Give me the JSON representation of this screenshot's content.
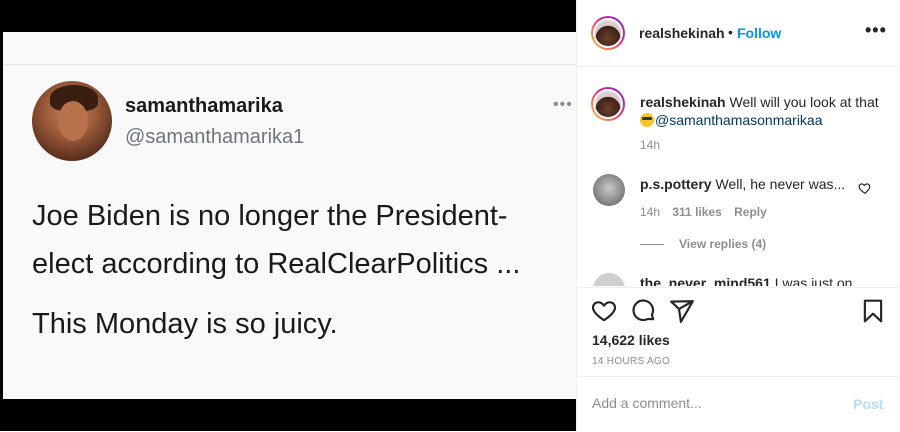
{
  "tweet": {
    "name": "samanthamarika",
    "handle": "@samanthamarika1",
    "line1": "Joe Biden is no longer the President-",
    "line2": "elect according to RealClearPolitics ...",
    "line3": "This Monday is so juicy.",
    "more": "•••"
  },
  "header": {
    "username": "realshekinah",
    "separator": "•",
    "follow_label": "Follow",
    "more": "•••"
  },
  "caption": {
    "username": "realshekinah",
    "text_prefix": "Well will you look at that",
    "mention": "@samanthamasonmarikaa",
    "time": "14h"
  },
  "comments": [
    {
      "username": "p.s.pottery",
      "text": "Well, he never was...",
      "time": "14h",
      "likes": "311 likes",
      "reply_label": "Reply",
      "view_replies": "View replies (4)"
    },
    {
      "username": "the_never_mind561",
      "text": "I was just on"
    }
  ],
  "actions": {
    "like_icon": "heart-icon",
    "comment_icon": "comment-icon",
    "share_icon": "paper-plane-icon",
    "save_icon": "bookmark-icon"
  },
  "likes_count": "14,622 likes",
  "posted_ago": "14 HOURS AGO",
  "add_comment": {
    "placeholder": "Add a comment...",
    "post_label": "Post"
  },
  "colors": {
    "link_blue": "#0095f6",
    "post_disabled": "#b2dffc",
    "mention": "#00376b",
    "muted": "#8e8e8e"
  }
}
